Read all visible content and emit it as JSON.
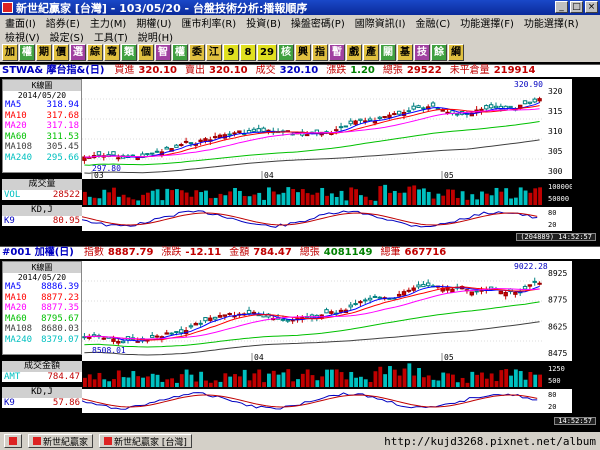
{
  "window": {
    "title": "新世紀贏家 [台灣] - 103/05/20 - 台盤技術分析:播報順序",
    "buttons": [
      "_",
      "□",
      "×"
    ]
  },
  "menu_row1": [
    "畫面(I)",
    "諮券(E)",
    "主力(M)",
    "期權(U)",
    "匯市利率(R)",
    "投資(B)",
    "操盤密碼(P)",
    "國際資訊(I)",
    "金融(C)",
    "功能選擇(F)",
    "功能選擇(R)"
  ],
  "menu_row2": [
    "檢視(V)",
    "設定(S)",
    "工具(T)",
    "說明(H)"
  ],
  "toolbar": [
    "加",
    "權",
    "期",
    "價",
    "選",
    "綜",
    "寫",
    "類",
    "個",
    "智",
    "權",
    "委",
    "江",
    "9",
    "8",
    "29",
    "核",
    "興",
    "指",
    "暫",
    "戲",
    "產",
    "關",
    "基",
    "技",
    "餘",
    "綱"
  ],
  "panel1": {
    "header": {
      "symbol": "STWA& 摩台指&(日)",
      "items": [
        {
          "label": "買進",
          "value": "320.10"
        },
        {
          "label": "賣出",
          "value": "320.10"
        },
        {
          "label": "成交",
          "value": "320.10"
        },
        {
          "label": "漲跌",
          "value": "1.20"
        },
        {
          "label": "總張",
          "value": "29522"
        },
        {
          "label": "未平倉量",
          "value": "219914"
        }
      ]
    },
    "legend": {
      "title": "K線圖",
      "date": "2014/05/20",
      "rows": [
        {
          "name": "MA5",
          "value": "318.94",
          "color": "#0000ff"
        },
        {
          "name": "MA10",
          "value": "317.68",
          "color": "#ff0000"
        },
        {
          "name": "MA20",
          "value": "317.18",
          "color": "#ff00ff"
        },
        {
          "name": "MA60",
          "value": "311.53",
          "color": "#00c000"
        },
        {
          "name": "MA108",
          "value": "305.45",
          "color": "#404040"
        },
        {
          "name": "MA240",
          "value": "295.66",
          "color": "#00c0c0"
        }
      ]
    },
    "high_label": "320.90",
    "low_label": "297.80",
    "y_ticks": [
      "320",
      "315",
      "310",
      "305",
      "300"
    ],
    "x_ticks": [
      "03",
      "04",
      "05"
    ],
    "vol": {
      "title": "成交量",
      "name": "VOL",
      "value": "28522",
      "y_ticks": [
        "100000",
        "50000"
      ]
    },
    "kd": {
      "title": "KD,J",
      "name": "K9",
      "value": "80.95",
      "y_ticks": [
        "80",
        "20"
      ]
    },
    "footer": "(204889) 14:52:57"
  },
  "panel2": {
    "header": {
      "symbol": "#001 加權(日)",
      "items": [
        {
          "label": "指數",
          "value": "8887.79"
        },
        {
          "label": "漲跌",
          "value": "-12.11"
        },
        {
          "label": "金額",
          "value": "784.47"
        },
        {
          "label": "總張",
          "value": "4081149"
        },
        {
          "label": "總筆",
          "value": "667716"
        }
      ]
    },
    "legend": {
      "title": "K線圖",
      "date": "2014/05/20",
      "rows": [
        {
          "name": "MA5",
          "value": "8886.39",
          "color": "#0000ff"
        },
        {
          "name": "MA10",
          "value": "8877.23",
          "color": "#ff0000"
        },
        {
          "name": "MA20",
          "value": "8877.35",
          "color": "#ff00ff"
        },
        {
          "name": "MA60",
          "value": "8795.67",
          "color": "#00c000"
        },
        {
          "name": "MA108",
          "value": "8680.03",
          "color": "#404040"
        },
        {
          "name": "MA240",
          "value": "8379.07",
          "color": "#00c0c0"
        }
      ]
    },
    "high_label": "9022.28",
    "low_label": "8508.01",
    "y_ticks": [
      "8925",
      "8775",
      "8625",
      "8475"
    ],
    "x_ticks": [
      "04",
      "05"
    ],
    "amt": {
      "title": "成交金額",
      "name": "AMT",
      "value": "784.47",
      "y_ticks": [
        "1250",
        "500"
      ]
    },
    "kd": {
      "title": "KD,J",
      "name": "K9",
      "value": "57.86",
      "y_ticks": [
        "80",
        "20"
      ]
    },
    "footer": "14:52:57"
  },
  "taskbar": [
    "",
    "新世紀贏家",
    "新世紀贏家 [台灣]"
  ],
  "url": "http://kujd3268.pixnet.net/album"
}
